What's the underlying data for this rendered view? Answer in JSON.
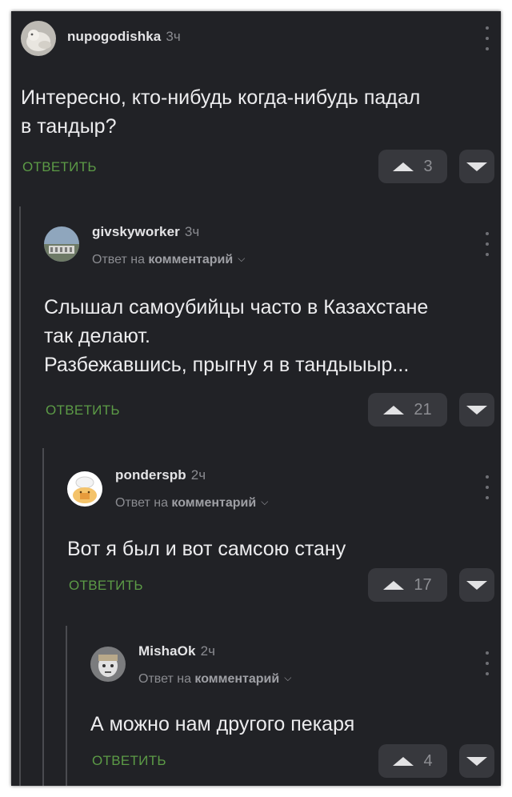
{
  "comments": [
    {
      "username": "nupogodishka",
      "time": "3ч",
      "reply_to": null,
      "lines": [
        "Интересно, кто-нибудь когда-нибудь падал",
        "в тандыр?"
      ],
      "reply_label": "ОТВЕТИТЬ",
      "votes": "3"
    },
    {
      "username": "givskyworker",
      "time": "3ч",
      "reply_to": {
        "prefix": "Ответ на",
        "target": "комментарий"
      },
      "lines": [
        "Слышал самоубийцы часто в Казахстане",
        "так делают.",
        "Разбежавшись, прыгну я в тандыыыр..."
      ],
      "reply_label": "ОТВЕТИТЬ",
      "votes": "21"
    },
    {
      "username": "ponderspb",
      "time": "2ч",
      "reply_to": {
        "prefix": "Ответ на",
        "target": "комментарий"
      },
      "lines": [
        "Вот я был и вот самсою стану"
      ],
      "reply_label": "ОТВЕТИТЬ",
      "votes": "17"
    },
    {
      "username": "MishaOk",
      "time": "2ч",
      "reply_to": {
        "prefix": "Ответ на",
        "target": "комментарий"
      },
      "lines": [
        "А можно нам другого пекаря"
      ],
      "reply_label": "ОТВЕТИТЬ",
      "votes": "4"
    }
  ],
  "colors": {
    "background": "#212226",
    "text": "#ececee",
    "reply_link": "#5c9b46",
    "vote_button": "#37383d"
  },
  "icons": {
    "upvote": "triangle-up-icon",
    "downvote": "triangle-down-icon",
    "more": "vertical-dots-icon",
    "reply_chevron": "chevron-down-icon"
  }
}
